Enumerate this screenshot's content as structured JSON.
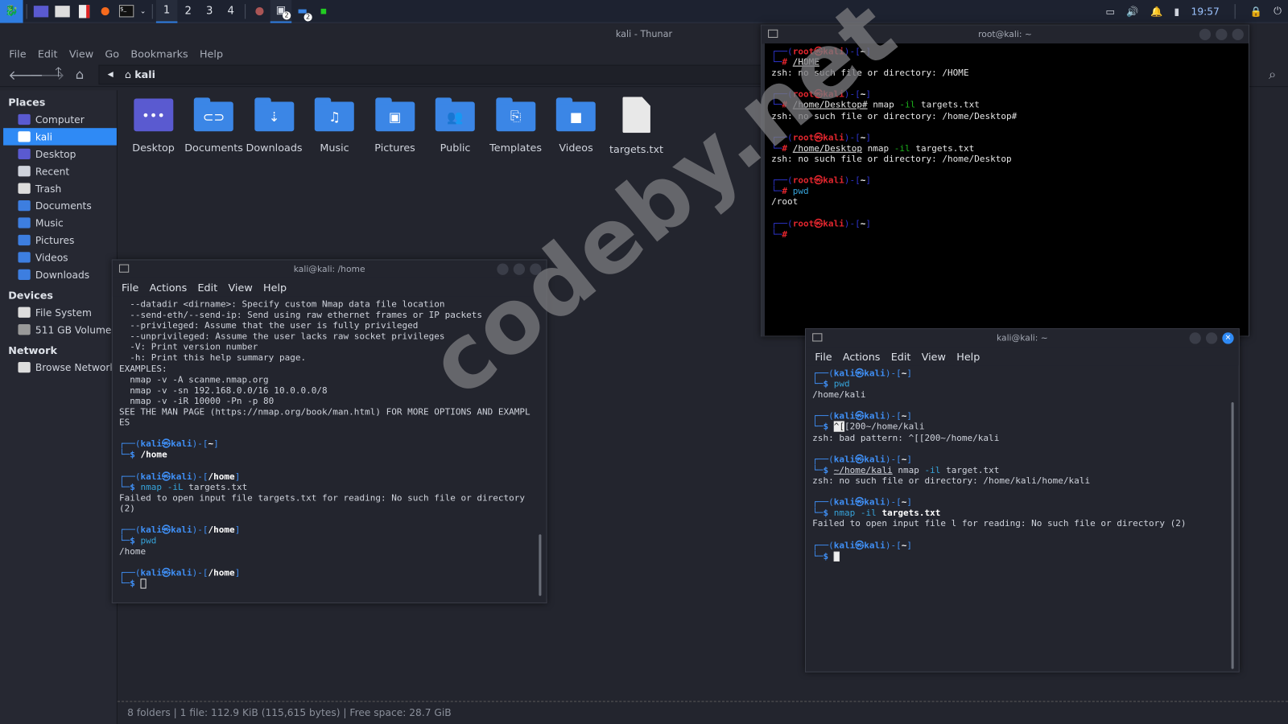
{
  "panel": {
    "workspaces": [
      "1",
      "2",
      "3",
      "4"
    ],
    "active_workspace": "1",
    "badges": [
      "2",
      "2"
    ],
    "clock": "19:57"
  },
  "thunar": {
    "title": "kali - Thunar",
    "menu": [
      "File",
      "Edit",
      "View",
      "Go",
      "Bookmarks",
      "Help"
    ],
    "location": "kali",
    "sidebar": [
      {
        "header": "Places",
        "items": [
          "Computer",
          "kali",
          "Desktop",
          "Recent",
          "Trash",
          "Documents",
          "Music",
          "Pictures",
          "Videos",
          "Downloads"
        ]
      },
      {
        "header": "Devices",
        "items": [
          "File System",
          "511 GB Volume"
        ]
      },
      {
        "header": "Network",
        "items": [
          "Browse Network"
        ]
      }
    ],
    "selected": "kali",
    "files": [
      {
        "name": "Desktop",
        "glyph": "•••"
      },
      {
        "name": "Documents",
        "glyph": "⊂⊃"
      },
      {
        "name": "Downloads",
        "glyph": "⇣"
      },
      {
        "name": "Music",
        "glyph": "♫"
      },
      {
        "name": "Pictures",
        "glyph": "▣"
      },
      {
        "name": "Public",
        "glyph": "👥"
      },
      {
        "name": "Templates",
        "glyph": "⎘"
      },
      {
        "name": "Videos",
        "glyph": "■"
      },
      {
        "name": "targets.txt",
        "glyph": ""
      }
    ],
    "status": "8 folders  |  1 file: 112.9 KiB (115,615 bytes)  |  Free space: 28.7 GiB"
  },
  "terminals": [
    {
      "title": "root@kali: ~",
      "menu": [],
      "lines": [
        {
          "p": "root",
          "user": "root",
          "host": "kali",
          "dir": "~"
        },
        {
          "c": [
            [
              "u",
              "/HOME"
            ]
          ]
        },
        {
          "o": "zsh: no such file or directory: /HOME"
        },
        {
          "o": ""
        },
        {
          "p": "root",
          "user": "root",
          "host": "kali",
          "dir": "~"
        },
        {
          "c": [
            [
              "u",
              "/home/Desktop#"
            ],
            [
              "n",
              " nmap "
            ],
            [
              "grn",
              "-il"
            ],
            [
              "n",
              " targets.txt"
            ]
          ]
        },
        {
          "o": "zsh: no such file or directory: /home/Desktop#"
        },
        {
          "o": ""
        },
        {
          "p": "root",
          "user": "root",
          "host": "kali",
          "dir": "~"
        },
        {
          "c": [
            [
              "u",
              "/home/Desktop"
            ],
            [
              "n",
              " nmap "
            ],
            [
              "grn",
              "-il"
            ],
            [
              "n",
              " targets.txt"
            ]
          ]
        },
        {
          "o": "zsh: no such file or directory: /home/Desktop"
        },
        {
          "o": ""
        },
        {
          "p": "root",
          "user": "root",
          "host": "kali",
          "dir": "~"
        },
        {
          "c": [
            [
              "cmd",
              "pwd"
            ]
          ]
        },
        {
          "o": "/root"
        },
        {
          "o": ""
        },
        {
          "p": "root",
          "user": "root",
          "host": "kali",
          "dir": "~"
        },
        {
          "c": []
        }
      ]
    },
    {
      "title": "kali@kali: /home",
      "menu": [
        "File",
        "Actions",
        "Edit",
        "View",
        "Help"
      ],
      "lines": [
        {
          "o": "  --datadir <dirname>: Specify custom Nmap data file location"
        },
        {
          "o": "  --send-eth/--send-ip: Send using raw ethernet frames or IP packets"
        },
        {
          "o": "  --privileged: Assume that the user is fully privileged"
        },
        {
          "o": "  --unprivileged: Assume the user lacks raw socket privileges"
        },
        {
          "o": "  -V: Print version number"
        },
        {
          "o": "  -h: Print this help summary page."
        },
        {
          "o": "EXAMPLES:"
        },
        {
          "o": "  nmap -v -A scanme.nmap.org"
        },
        {
          "o": "  nmap -v -sn 192.168.0.0/16 10.0.0.0/8"
        },
        {
          "o": "  nmap -v -iR 10000 -Pn -p 80"
        },
        {
          "o": "SEE THE MAN PAGE (https://nmap.org/book/man.html) FOR MORE OPTIONS AND EXAMPL"
        },
        {
          "o": "ES"
        },
        {
          "o": ""
        },
        {
          "p": "user",
          "user": "kali",
          "host": "kali",
          "dir": "~"
        },
        {
          "c": [
            [
              "b",
              "/home"
            ]
          ]
        },
        {
          "o": ""
        },
        {
          "p": "user",
          "user": "kali",
          "host": "kali",
          "dir": "/home"
        },
        {
          "c": [
            [
              "cmd",
              "nmap"
            ],
            [
              "cmd",
              " -iL"
            ],
            [
              "n",
              " targets.txt"
            ]
          ]
        },
        {
          "o": "Failed to open input file targets.txt for reading: No such file or directory"
        },
        {
          "o": "(2)"
        },
        {
          "o": ""
        },
        {
          "p": "user",
          "user": "kali",
          "host": "kali",
          "dir": "/home"
        },
        {
          "c": [
            [
              "cmd",
              "pwd"
            ]
          ]
        },
        {
          "o": "/home"
        },
        {
          "o": ""
        },
        {
          "p": "user",
          "user": "kali",
          "host": "kali",
          "dir": "/home"
        },
        {
          "c": [
            [
              "cur",
              ""
            ]
          ]
        }
      ]
    },
    {
      "title": "kali@kali: ~",
      "menu": [
        "File",
        "Actions",
        "Edit",
        "View",
        "Help"
      ],
      "lines": [
        {
          "p": "user",
          "user": "kali",
          "host": "kali",
          "dir": "~"
        },
        {
          "c": [
            [
              "cmd",
              "pwd"
            ]
          ]
        },
        {
          "o": "/home/kali"
        },
        {
          "o": ""
        },
        {
          "p": "user",
          "user": "kali",
          "host": "kali",
          "dir": "~"
        },
        {
          "c": [
            [
              "hl",
              "^["
            ],
            [
              "n",
              "[200~/home/kali"
            ]
          ]
        },
        {
          "o": "zsh: bad pattern: ^[[200~/home/kali"
        },
        {
          "o": ""
        },
        {
          "p": "user",
          "user": "kali",
          "host": "kali",
          "dir": "~"
        },
        {
          "c": [
            [
              "u",
              "~/home/kali"
            ],
            [
              "n",
              " nmap "
            ],
            [
              "cmd",
              "-il"
            ],
            [
              "n",
              " target.txt"
            ]
          ]
        },
        {
          "o": "zsh: no such file or directory: /home/kali/home/kali"
        },
        {
          "o": ""
        },
        {
          "p": "user",
          "user": "kali",
          "host": "kali",
          "dir": "~"
        },
        {
          "c": [
            [
              "cmd",
              "nmap -il "
            ],
            [
              "b",
              "targets.txt"
            ]
          ]
        },
        {
          "o": "Failed to open input file l for reading: No such file or directory (2)"
        },
        {
          "o": ""
        },
        {
          "p": "user",
          "user": "kali",
          "host": "kali",
          "dir": "~"
        },
        {
          "c": [
            [
              "curf",
              ""
            ]
          ]
        }
      ]
    }
  ],
  "watermark": "codeby.net"
}
